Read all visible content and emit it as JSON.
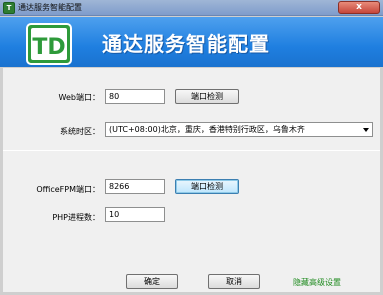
{
  "window": {
    "title": "通达服务智能配置",
    "close_label": "x",
    "icon_letter": "T"
  },
  "banner": {
    "title": "通达服务智能配置",
    "logo_text": "TD"
  },
  "form": {
    "web_port": {
      "label": "Web端口：",
      "value": "80",
      "check_button": "端口检测"
    },
    "timezone": {
      "label": "系统时区：",
      "value": "(UTC+08:00)北京，重庆，香港特别行政区，乌鲁木齐"
    },
    "office_fpm_port": {
      "label": "OfficeFPM端口：",
      "value": "8266",
      "check_button": "端口检测"
    },
    "php_processes": {
      "label": "PHP进程数：",
      "value": "10"
    }
  },
  "footer": {
    "ok_label": "确定",
    "cancel_label": "取消",
    "advanced_link": "隐藏高级设置"
  },
  "colors": {
    "banner_blue": "#1f7fe0",
    "logo_green": "#2e9a3a",
    "link_green": "#1e8a1e"
  }
}
